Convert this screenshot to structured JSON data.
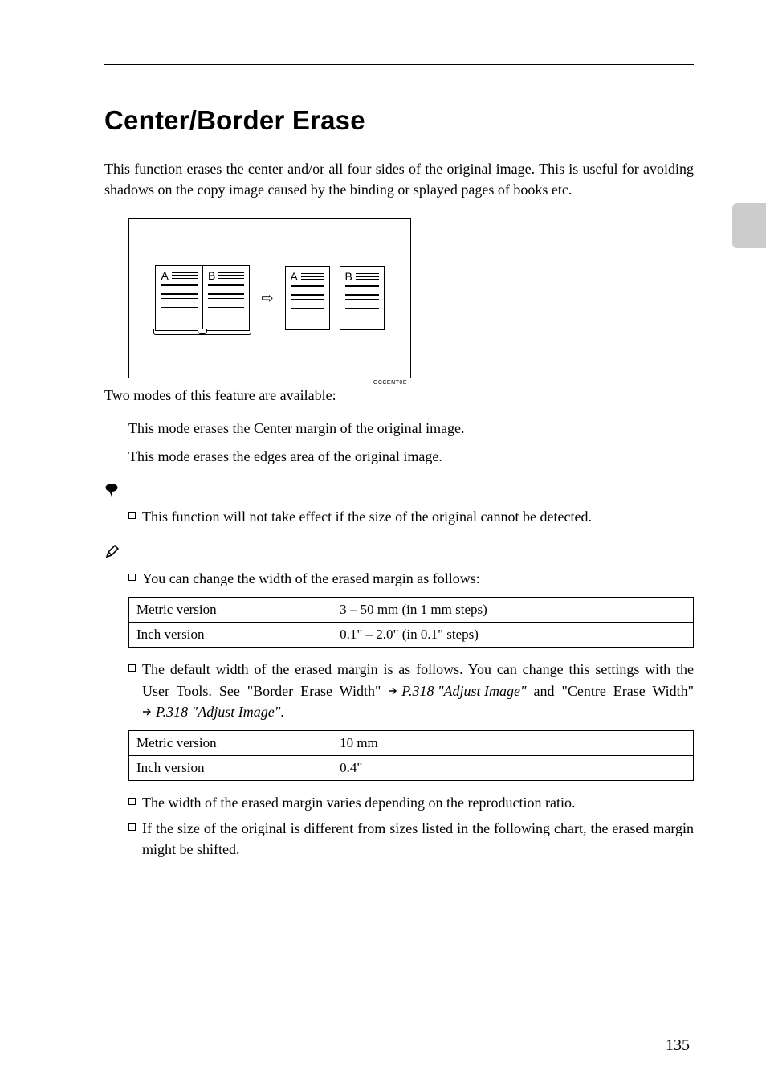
{
  "heading": "Center/Border Erase",
  "intro": "This function erases the center and/or all four sides of the original image. This is useful for avoiding shadows on the copy image caused by the binding or splayed pages of books etc.",
  "figure_label": "GCCENT0E",
  "page_letters": {
    "a": "A",
    "b": "B"
  },
  "modes_intro": "Two modes of this feature are available:",
  "modes": {
    "center": "This mode erases the Center margin of the original image.",
    "border": "This mode erases the edges area of the original image."
  },
  "limitation_bullet": "This function will not take effect if the size of the original cannot be detected.",
  "notes": {
    "width_change": "You can change the width of the erased margin as follows:",
    "default_intro": "The default width of the erased margin is as follows. You can change this settings with the User Tools. See \"Border Erase Width\" ",
    "ref_text": "P.318 \"Adjust Image\"",
    "and_text": " and \"Centre Erase Width\" ",
    "ref_text2": "P.318 \"Adjust Image\"",
    "period": ".",
    "vary": "The width of the erased margin varies depending on the reproduction ratio.",
    "shift": "If the size of the original is different from sizes listed in the following chart, the erased margin might be shifted."
  },
  "table1": {
    "r1c1": "Metric version",
    "r1c2": "3 – 50 mm (in 1 mm steps)",
    "r2c1": "Inch version",
    "r2c2": "0.1\" – 2.0\" (in 0.1\" steps)"
  },
  "table2": {
    "r1c1": "Metric version",
    "r1c2": "10 mm",
    "r2c1": "Inch version",
    "r2c2": "0.4\""
  },
  "page_number": "135"
}
